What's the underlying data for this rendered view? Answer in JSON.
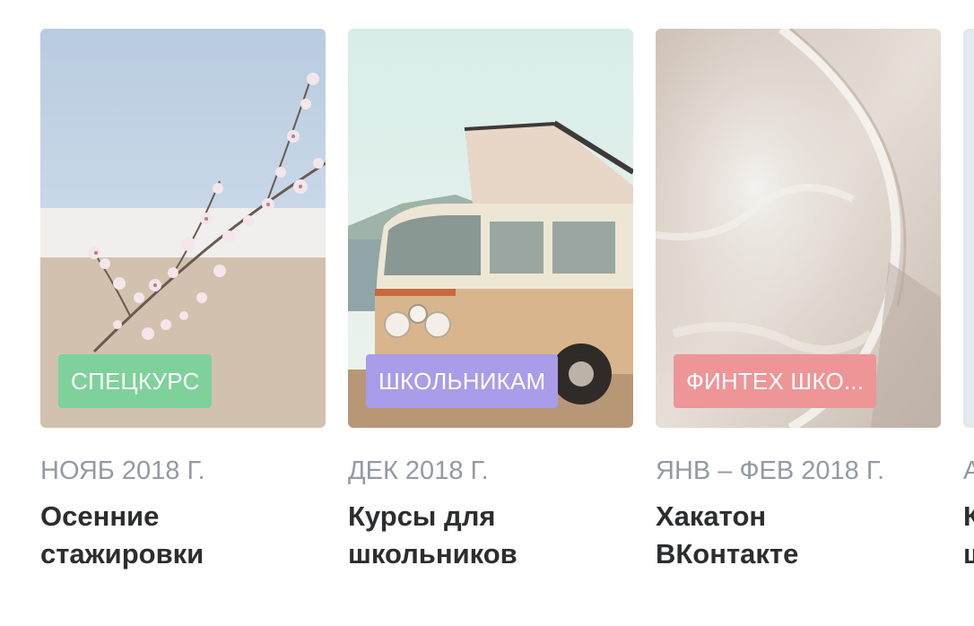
{
  "cards": [
    {
      "tag": "СПЕЦКУРС",
      "tag_color": "#7fd19b",
      "date": "НОЯБ 2018 Г.",
      "title_line1": "Осенние",
      "title_line2": "стажировки",
      "image": "cherry-blossom-branch"
    },
    {
      "tag": "ШКОЛЬНИКАМ",
      "tag_color": "#a99ce8",
      "date": "ДЕК 2018 Г.",
      "title_line1": "Курсы для",
      "title_line2": "школьников",
      "image": "vintage-camper-van"
    },
    {
      "tag": "ФИНТЕХ ШКО...",
      "tag_color": "#ee9597",
      "date": "ЯНВ – ФЕВ 2018 Г.",
      "title_line1": "Хакатон",
      "title_line2": "ВКонтакте",
      "image": "ice-surface"
    },
    {
      "tag": "",
      "tag_color": "#dfe3ea",
      "date": "А",
      "title_line1": "К",
      "title_line2": "ш",
      "image": "partial-card"
    }
  ]
}
